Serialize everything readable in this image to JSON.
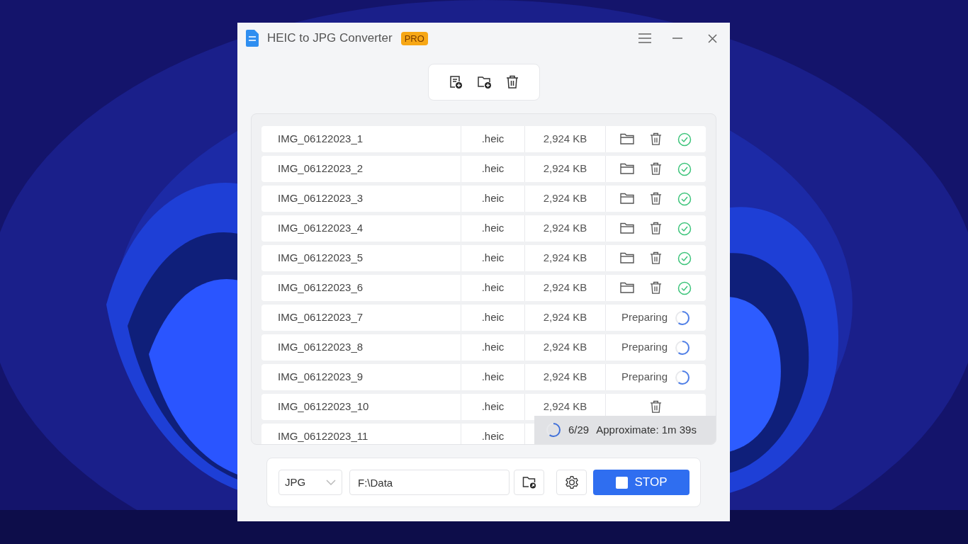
{
  "window": {
    "title": "HEIC to JPG Converter",
    "badge": "PRO"
  },
  "files": [
    {
      "name": "IMG_06122023_1",
      "ext": ".heic",
      "size": "2,924 KB",
      "kind": "done"
    },
    {
      "name": "IMG_06122023_2",
      "ext": ".heic",
      "size": "2,924 KB",
      "kind": "done"
    },
    {
      "name": "IMG_06122023_3",
      "ext": ".heic",
      "size": "2,924 KB",
      "kind": "done"
    },
    {
      "name": "IMG_06122023_4",
      "ext": ".heic",
      "size": "2,924 KB",
      "kind": "done"
    },
    {
      "name": "IMG_06122023_5",
      "ext": ".heic",
      "size": "2,924 KB",
      "kind": "done"
    },
    {
      "name": "IMG_06122023_6",
      "ext": ".heic",
      "size": "2,924 KB",
      "kind": "done"
    },
    {
      "name": "IMG_06122023_7",
      "ext": ".heic",
      "size": "2,924 KB",
      "kind": "preparing",
      "status": "Preparing"
    },
    {
      "name": "IMG_06122023_8",
      "ext": ".heic",
      "size": "2,924 KB",
      "kind": "preparing",
      "status": "Preparing"
    },
    {
      "name": "IMG_06122023_9",
      "ext": ".heic",
      "size": "2,924 KB",
      "kind": "preparing",
      "status": "Preparing"
    },
    {
      "name": "IMG_06122023_10",
      "ext": ".heic",
      "size": "2,924 KB",
      "kind": "queued"
    },
    {
      "name": "IMG_06122023_11",
      "ext": ".heic",
      "kind": "partial"
    }
  ],
  "progress": {
    "count": "6/29",
    "estimate": "Approximate: 1m 39s"
  },
  "output": {
    "format": "JPG",
    "path": "F:\\Data",
    "button": "STOP"
  }
}
